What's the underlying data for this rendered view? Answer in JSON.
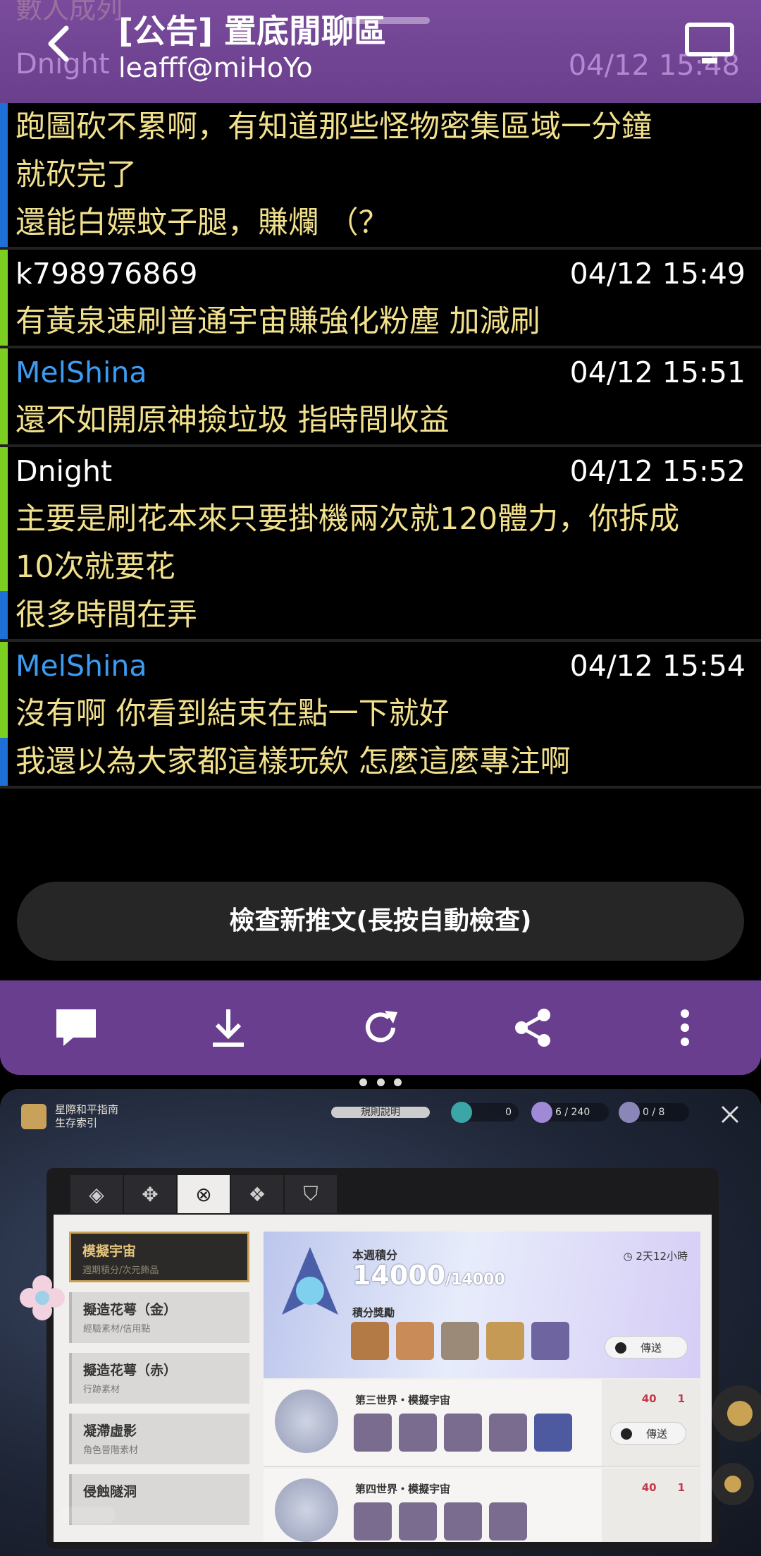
{
  "header": {
    "title": "[公告] 置底閒聊區",
    "subtitle": "leafff@miHoYo",
    "under_name": "Dnight",
    "under_time": "04/12 15:48",
    "top_fade": "數人成列"
  },
  "posts": [
    {
      "name": "",
      "time": "",
      "name_color": "#ffffff",
      "bar": "#1e6fd6",
      "lines": [
        {
          "text": "跑圖砍不累啊，有知道那些怪物密集區域一分鐘",
          "bar": "#1e6fd6"
        },
        {
          "text": "就砍完了",
          "bar": "#1e6fd6"
        },
        {
          "text": "還能白嫖蚊子腿，賺爛 （？",
          "bar": "#1e6fd6"
        }
      ]
    },
    {
      "name": "k798976869",
      "time": "04/12 15:49",
      "name_color": "#ffffff",
      "bar": "#7ccf21",
      "lines": [
        {
          "text": "有黃泉速刷普通宇宙賺強化粉塵 加減刷",
          "bar": "#7ccf21"
        }
      ]
    },
    {
      "name": "MelShina",
      "time": "04/12 15:51",
      "name_color": "#3a9cf2",
      "bar": "#7ccf21",
      "lines": [
        {
          "text": "還不如開原神撿垃圾 指時間收益",
          "bar": "#7ccf21"
        }
      ]
    },
    {
      "name": "Dnight",
      "time": "04/12 15:52",
      "name_color": "#ffffff",
      "bar": "#7ccf21",
      "lines": [
        {
          "text": "主要是刷花本來只要掛機兩次就120體力，你拆成",
          "bar": "#7ccf21"
        },
        {
          "text": "10次就要花",
          "bar": "#7ccf21"
        },
        {
          "text": "很多時間在弄",
          "bar": "#1e6fd6"
        }
      ]
    },
    {
      "name": "MelShina",
      "time": "04/12 15:54",
      "name_color": "#3a9cf2",
      "bar": "#7ccf21",
      "lines": [
        {
          "text": "沒有啊 你看到結束在點一下就好",
          "bar": "#7ccf21"
        },
        {
          "text": "我還以為大家都這樣玩欸 怎麼這麼專注啊",
          "bar": "#1e6fd6"
        }
      ]
    }
  ],
  "check_button": "檢查新推文(長按自動檢查)",
  "toolbar": [
    "comment-icon",
    "download-icon",
    "refresh-icon",
    "share-icon",
    "more-vertical-icon"
  ],
  "game": {
    "guide_line1": "星際和平指南",
    "guide_line2": "生存索引",
    "rules": "規則說明",
    "res1": "0",
    "res2": "6 / 240",
    "res3": "0 / 8",
    "side_items": [
      {
        "title": "模擬宇宙",
        "sub": "週期積分/次元飾品"
      },
      {
        "title": "擬造花萼（金）",
        "sub": "經驗素材/信用點"
      },
      {
        "title": "擬造花萼（赤）",
        "sub": "行跡素材"
      },
      {
        "title": "凝滯虛影",
        "sub": "角色晉階素材"
      },
      {
        "title": "侵蝕隧洞",
        "sub": ""
      }
    ],
    "score_label": "本週積分",
    "score_value": "14000",
    "score_max": "/14000",
    "time_left": "2天12小時",
    "reward_label": "積分獎勵",
    "send": "傳送",
    "rows": [
      {
        "title": "第三世界・模擬宇宙",
        "cost1": "40",
        "cost2": "1"
      },
      {
        "title": "第四世界・模擬宇宙",
        "cost1": "40",
        "cost2": "1"
      }
    ]
  }
}
